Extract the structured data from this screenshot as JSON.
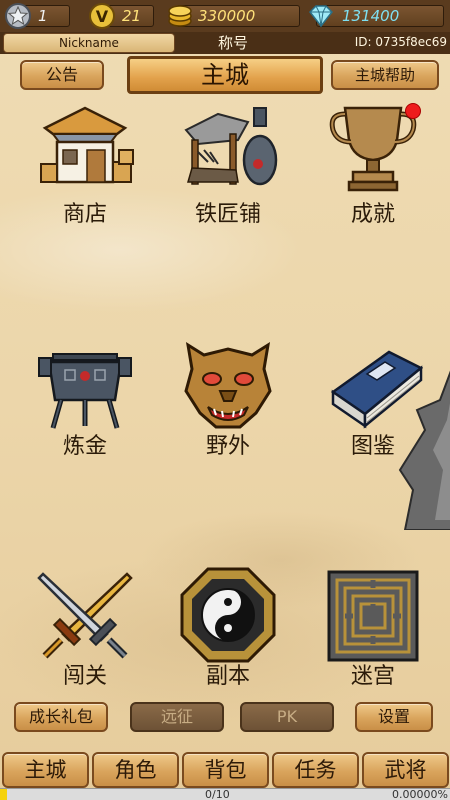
{
  "resources": {
    "rank": "1",
    "vip": "21",
    "gold": "330000",
    "diamond": "131400"
  },
  "player": {
    "nickname": "Nickname",
    "title": "称号",
    "id": "ID: 0735f8ec69"
  },
  "header": {
    "notice": "公告",
    "title": "主城",
    "help": "主城帮助"
  },
  "buildings": [
    {
      "label": "商店",
      "icon": "shop-house-icon"
    },
    {
      "label": "铁匠铺",
      "icon": "blacksmith-icon"
    },
    {
      "label": "成就",
      "icon": "trophy-icon",
      "has_notification": true
    },
    {
      "label": "炼金",
      "icon": "cauldron-icon"
    },
    {
      "label": "野外",
      "icon": "beast-mask-icon"
    },
    {
      "label": "图鉴",
      "icon": "book-icon"
    },
    {
      "label": "闯关",
      "icon": "crossed-swords-icon"
    },
    {
      "label": "副本",
      "icon": "bagua-yinyang-icon"
    },
    {
      "label": "迷宫",
      "icon": "maze-icon"
    }
  ],
  "actions": {
    "growth_pack": "成长礼包",
    "expedition": "远征",
    "pk": "PK",
    "settings": "设置"
  },
  "nav": {
    "tabs": [
      "主城",
      "角色",
      "背包",
      "任务",
      "武将"
    ]
  },
  "experience": {
    "text": "0/10",
    "percent": "0.00000%",
    "fraction": 0.015
  },
  "colors": {
    "accent_gold": "#ffe27a",
    "diamond": "#7ee0f2",
    "notification": "#ee1c1c"
  }
}
